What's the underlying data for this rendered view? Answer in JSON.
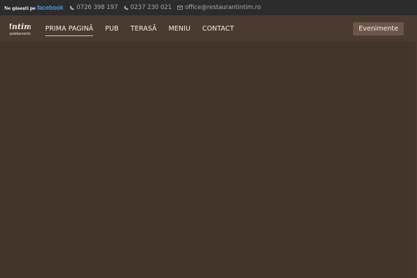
{
  "topbar": {
    "facebook_prefix": "Ne găsești pe",
    "facebook_brand": "facebook",
    "phone1": "0726 398 197",
    "phone2": "0237 230 021",
    "email": "office@restaurantintim.ro"
  },
  "logo": {
    "text": "Intim",
    "subtext": "pub&events"
  },
  "nav": {
    "items": [
      {
        "label": "PRIMA PAGINĂ",
        "active": true
      },
      {
        "label": "PUB"
      },
      {
        "label": "TERASĂ"
      },
      {
        "label": "MENIU"
      },
      {
        "label": "CONTACT"
      }
    ],
    "events_button": "Evenimente"
  },
  "colors": {
    "topbar_bg": "#2c2c2c",
    "navbar_bg": "#4a3a30",
    "page_bg": "#433529",
    "button_bg": "#6d5649",
    "facebook_blue": "#4a90e2"
  }
}
